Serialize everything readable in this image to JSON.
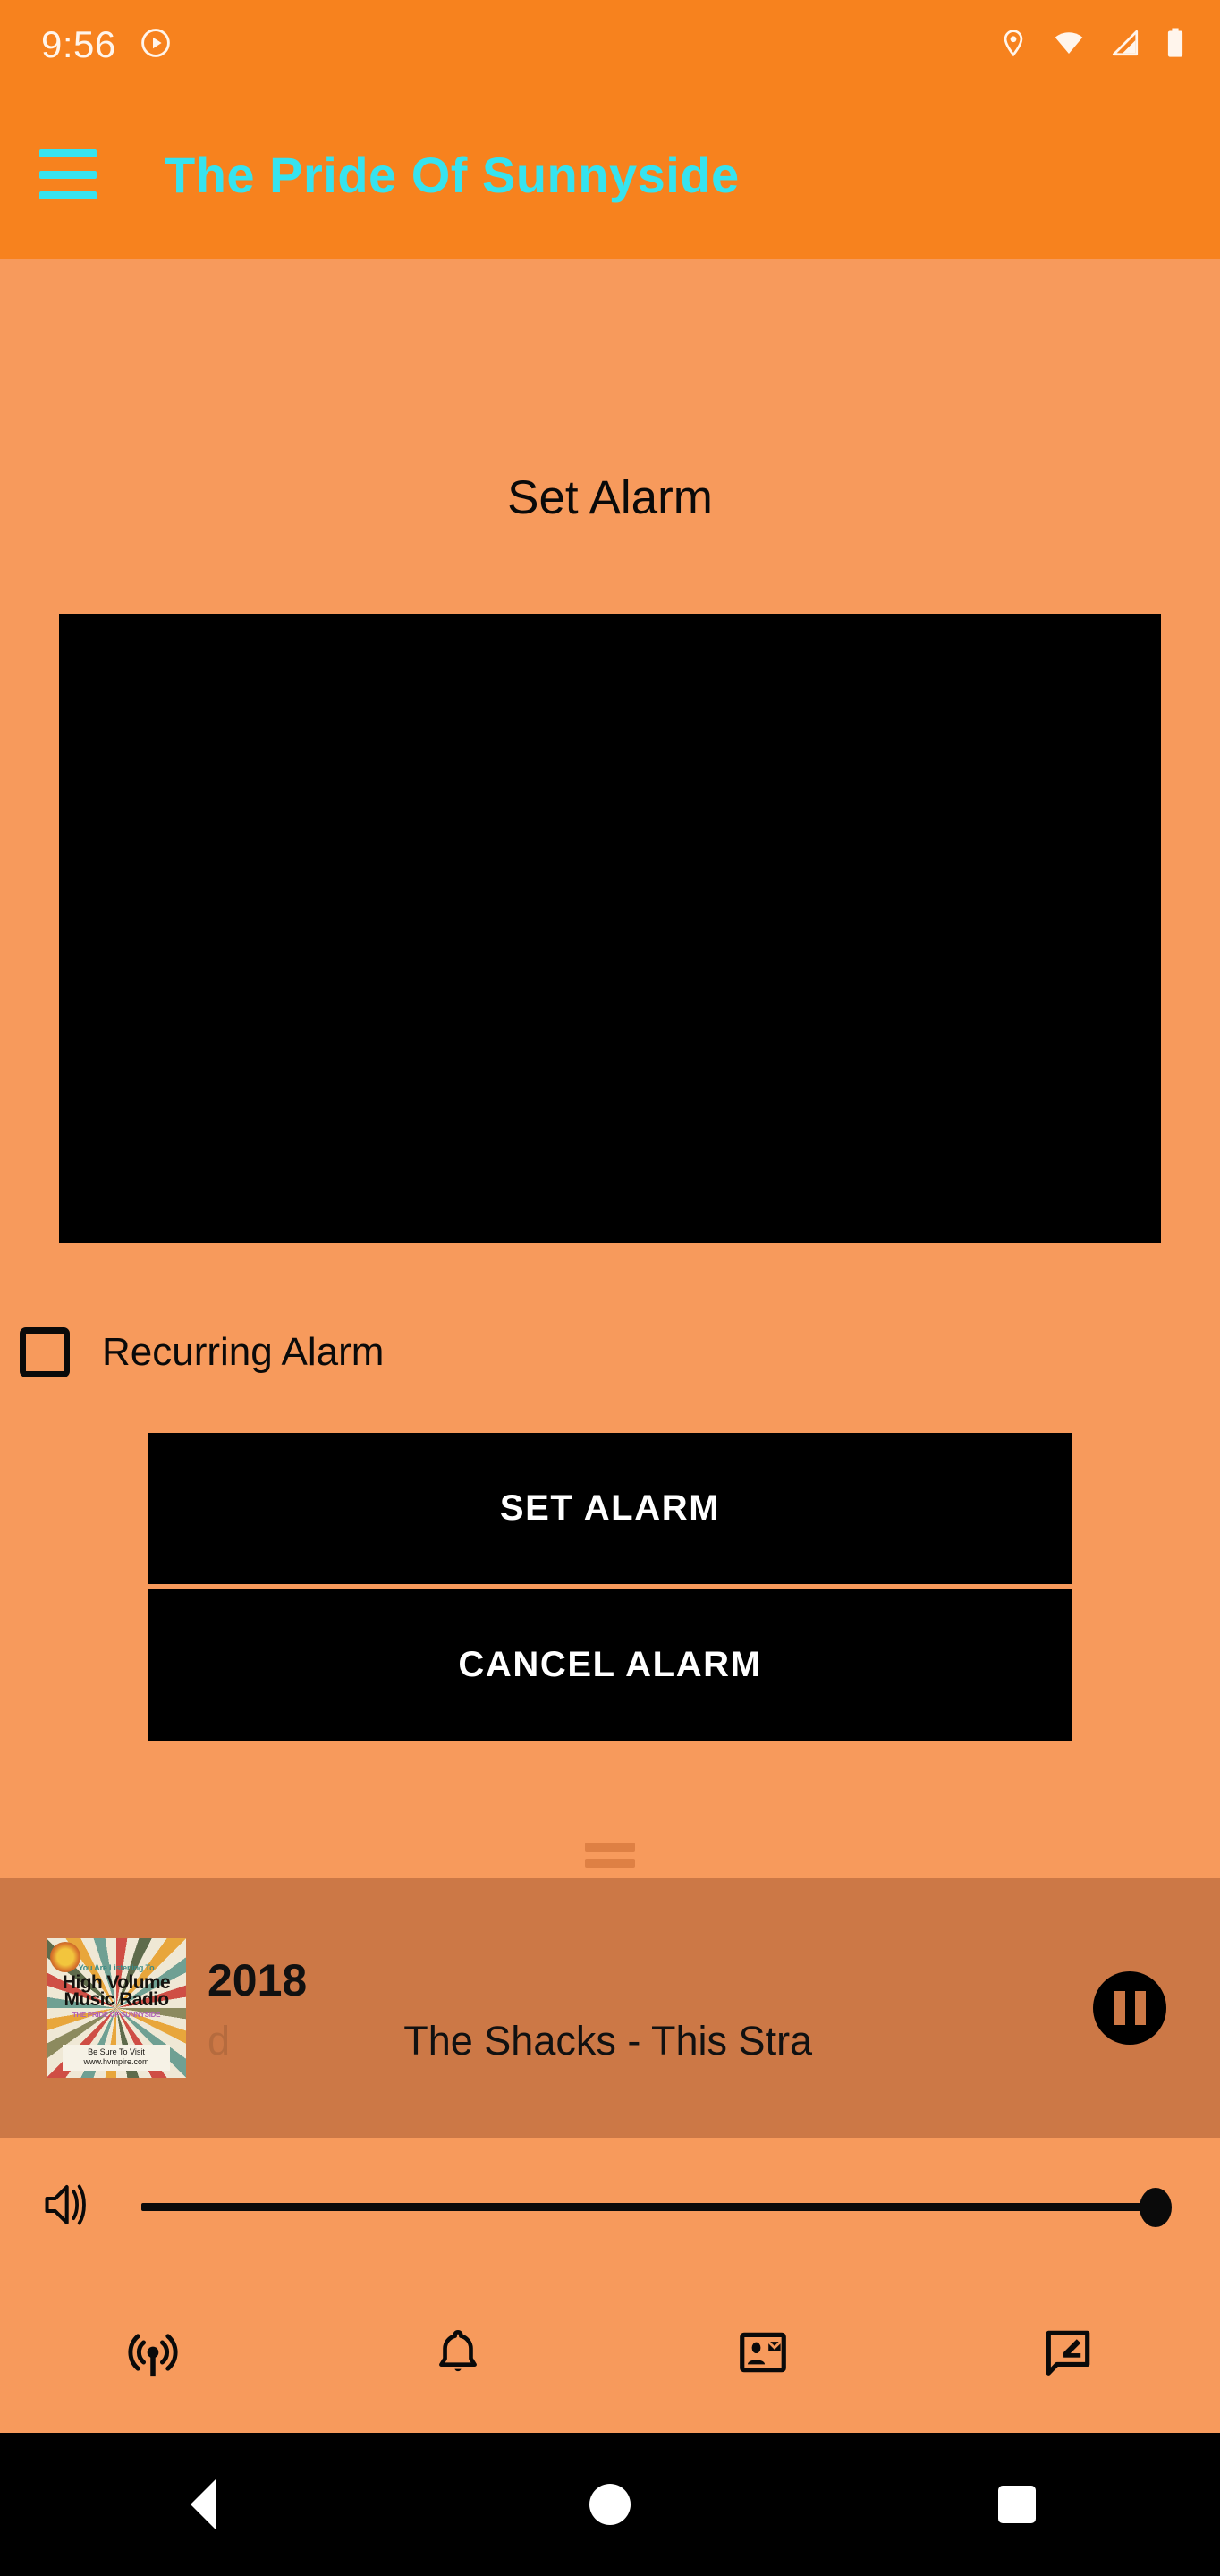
{
  "status_bar": {
    "clock": "9:56",
    "icons": [
      "play-circle-icon",
      "location-icon",
      "wifi-icon",
      "cellular-signal-icon",
      "battery-icon"
    ]
  },
  "app_bar": {
    "menu_icon": "hamburger-menu-icon",
    "title": "The Pride Of Sunnyside",
    "title_color": "#36E3EF",
    "background_color": "#F7821E"
  },
  "alarm_panel": {
    "section_title": "Set Alarm",
    "timepicker_placeholder": "",
    "recurring": {
      "label": "Recurring Alarm",
      "checked": false
    },
    "buttons": [
      {
        "label": "SET ALARM",
        "name": "set-alarm-button"
      },
      {
        "label": "CANCEL ALARM",
        "name": "cancel-alarm-button"
      }
    ],
    "drag_handle": "expand-handle"
  },
  "player": {
    "album_art": {
      "line_top": "You Are Listening To",
      "line_main": "High Volume\nMusic Radio",
      "line_main_1": "High Volume",
      "line_main_2": "Music Radio",
      "line_sub": "THE PRIDE OF SUNNYSIDE",
      "box_line_1": "Be Sure To Visit",
      "box_line_2": "www.hvmpire.com"
    },
    "track_line_1": "2018",
    "track_line_1_ghost": "d",
    "track_line_2": "The Shacks - This Stra",
    "track_line_2_lead": "d",
    "transport_state": "playing",
    "transport_icon": "pause-icon",
    "background_color": "#CC7846"
  },
  "volume": {
    "icon": "volume-up-icon",
    "value": 100,
    "min": 0,
    "max": 100
  },
  "bottom_nav": [
    {
      "name": "nav-item-stations",
      "icon": "broadcast-icon"
    },
    {
      "name": "nav-item-alarm",
      "icon": "bell-icon"
    },
    {
      "name": "nav-item-contact",
      "icon": "contact-mail-icon"
    },
    {
      "name": "nav-item-review",
      "icon": "rate-review-icon"
    }
  ],
  "android_nav": [
    {
      "name": "android-back-button",
      "icon": "back-triangle-icon"
    },
    {
      "name": "android-home-button",
      "icon": "home-circle-icon"
    },
    {
      "name": "android-recents-button",
      "icon": "recents-square-icon"
    }
  ],
  "colors": {
    "app_bar": "#F7821E",
    "page_background": "#F79A5C",
    "accent": "#36E3EF",
    "player_background": "#CC7846",
    "button_background": "#000000"
  }
}
